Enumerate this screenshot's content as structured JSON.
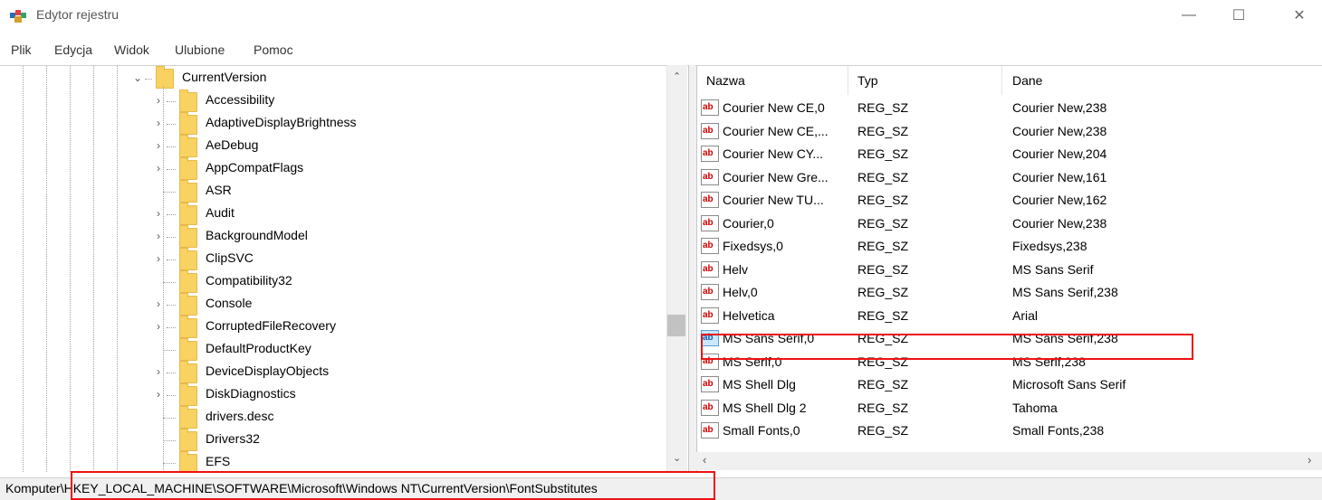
{
  "window": {
    "title": "Edytor rejestru",
    "controls": {
      "minimize": "—",
      "maximize": "☐",
      "close": "✕"
    }
  },
  "menu": [
    "Plik",
    "Edycja",
    "Widok",
    "Ulubione",
    "Pomoc"
  ],
  "tree": {
    "expanded_node": "CurrentVersion",
    "children": [
      {
        "label": "Accessibility",
        "expandable": true
      },
      {
        "label": "AdaptiveDisplayBrightness",
        "expandable": true
      },
      {
        "label": "AeDebug",
        "expandable": true
      },
      {
        "label": "AppCompatFlags",
        "expandable": true
      },
      {
        "label": "ASR",
        "expandable": false
      },
      {
        "label": "Audit",
        "expandable": true
      },
      {
        "label": "BackgroundModel",
        "expandable": true
      },
      {
        "label": "ClipSVC",
        "expandable": true
      },
      {
        "label": "Compatibility32",
        "expandable": false
      },
      {
        "label": "Console",
        "expandable": true
      },
      {
        "label": "CorruptedFileRecovery",
        "expandable": true
      },
      {
        "label": "DefaultProductKey",
        "expandable": false
      },
      {
        "label": "DeviceDisplayObjects",
        "expandable": true
      },
      {
        "label": "DiskDiagnostics",
        "expandable": true
      },
      {
        "label": "drivers.desc",
        "expandable": false
      },
      {
        "label": "Drivers32",
        "expandable": false
      },
      {
        "label": "EFS",
        "expandable": false
      }
    ]
  },
  "list": {
    "columns": [
      "Nazwa",
      "Typ",
      "Dane"
    ],
    "icon_text": "ab",
    "rows": [
      {
        "name": "Courier New CE,0",
        "type": "REG_SZ",
        "data": "Courier New,238"
      },
      {
        "name": "Courier New CE,...",
        "type": "REG_SZ",
        "data": "Courier New,238"
      },
      {
        "name": "Courier New CY...",
        "type": "REG_SZ",
        "data": "Courier New,204"
      },
      {
        "name": "Courier New Gre...",
        "type": "REG_SZ",
        "data": "Courier New,161"
      },
      {
        "name": "Courier New TU...",
        "type": "REG_SZ",
        "data": "Courier New,162"
      },
      {
        "name": "Courier,0",
        "type": "REG_SZ",
        "data": "Courier New,238"
      },
      {
        "name": "Fixedsys,0",
        "type": "REG_SZ",
        "data": "Fixedsys,238"
      },
      {
        "name": "Helv",
        "type": "REG_SZ",
        "data": "MS Sans Serif"
      },
      {
        "name": "Helv,0",
        "type": "REG_SZ",
        "data": "MS Sans Serif,238"
      },
      {
        "name": "Helvetica",
        "type": "REG_SZ",
        "data": "Arial"
      },
      {
        "name": "MS Sans Serif,0",
        "type": "REG_SZ",
        "data": "MS Sans Serif,238",
        "selected": true
      },
      {
        "name": "MS Serif,0",
        "type": "REG_SZ",
        "data": "MS Serif,238"
      },
      {
        "name": "MS Shell Dlg",
        "type": "REG_SZ",
        "data": "Microsoft Sans Serif"
      },
      {
        "name": "MS Shell Dlg 2",
        "type": "REG_SZ",
        "data": "Tahoma"
      },
      {
        "name": "Small Fonts,0",
        "type": "REG_SZ",
        "data": "Small Fonts,238"
      }
    ]
  },
  "status_bar": {
    "path": "Komputer\\HKEY_LOCAL_MACHINE\\SOFTWARE\\Microsoft\\Windows NT\\CurrentVersion\\FontSubstitutes"
  },
  "colors": {
    "highlight_box": "#e11111",
    "folder": "#f9d262",
    "selected_icon": "#cce8ff"
  }
}
